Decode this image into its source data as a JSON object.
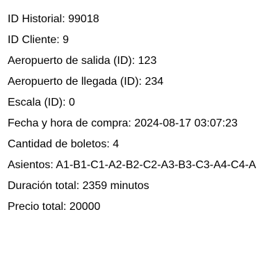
{
  "record": {
    "lines": [
      "ID Historial: 99018",
      "ID Cliente: 9",
      "Aeropuerto de salida (ID): 123",
      "Aeropuerto de llegada (ID): 234",
      "Escala (ID): 0",
      "Fecha y hora de compra: 2024-08-17 03:07:23",
      "Cantidad de boletos: 4",
      "Asientos: A1-B1-C1-A2-B2-C2-A3-B3-C3-A4-C4-A",
      "Duración total: 2359 minutos",
      "Precio total: 20000"
    ]
  }
}
